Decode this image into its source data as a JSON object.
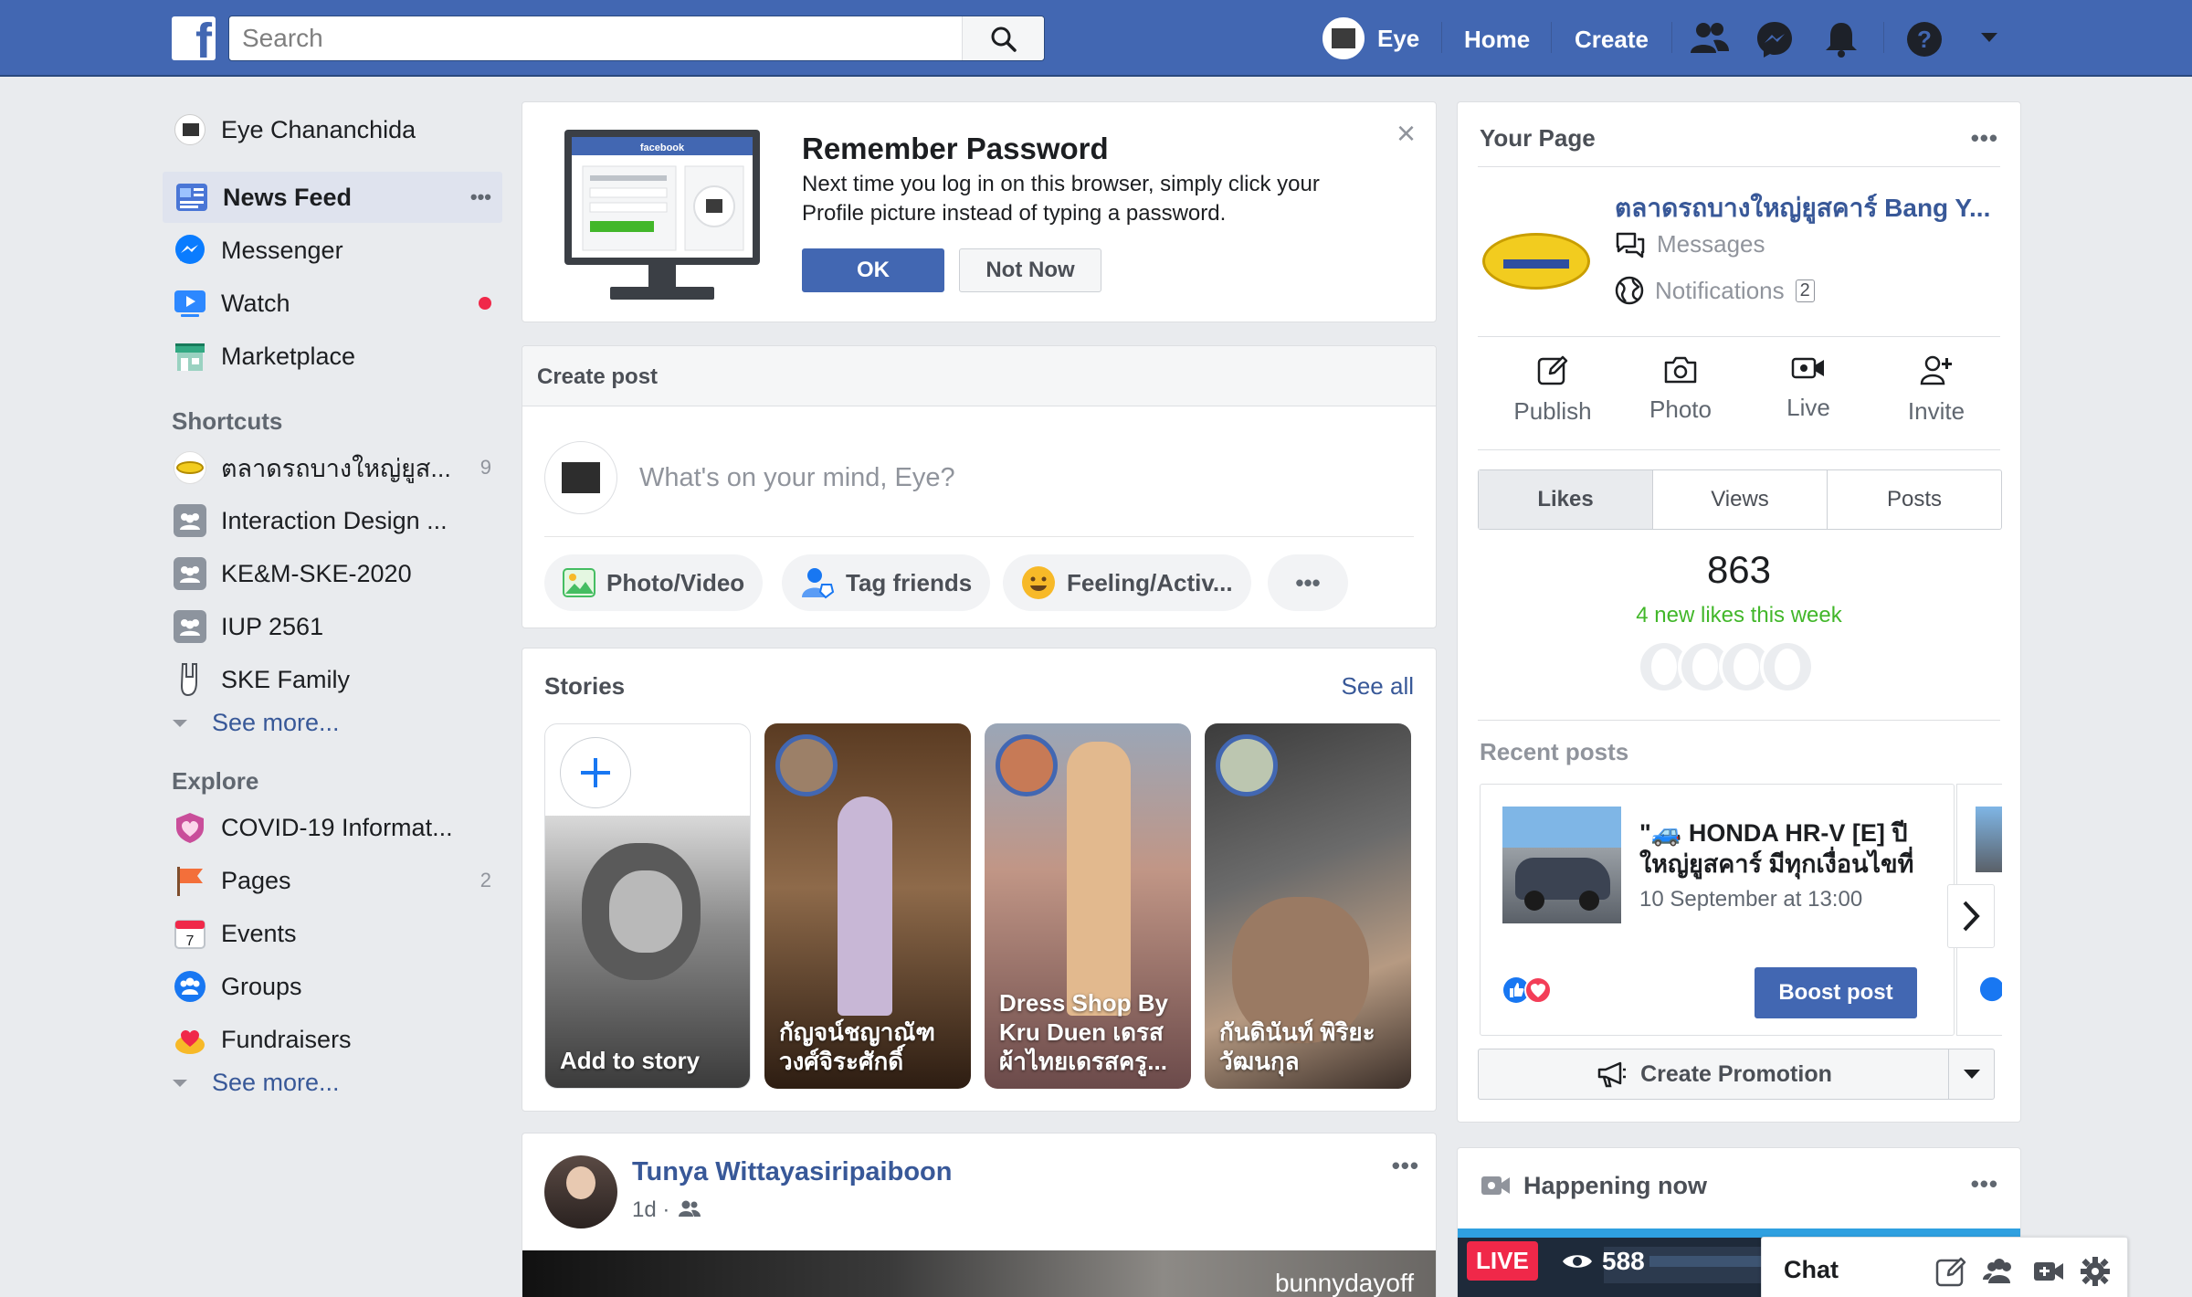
{
  "topbar": {
    "logo": "f",
    "search_placeholder": "Search",
    "profile_name": "Eye",
    "home": "Home",
    "create": "Create"
  },
  "sidebar": {
    "profile": "Eye Chananchida",
    "items": [
      {
        "label": "News Feed",
        "icon": "news-feed-icon"
      },
      {
        "label": "Messenger",
        "icon": "messenger-icon"
      },
      {
        "label": "Watch",
        "icon": "watch-icon"
      },
      {
        "label": "Marketplace",
        "icon": "marketplace-icon"
      }
    ],
    "more_dots": "•••",
    "shortcuts_heading": "Shortcuts",
    "shortcuts": [
      {
        "label": "ตลาดรถบางใหญ่ยูส...",
        "count": "9"
      },
      {
        "label": "Interaction Design ..."
      },
      {
        "label": "KE&M-SKE-2020"
      },
      {
        "label": "IUP 2561"
      },
      {
        "label": "SKE Family"
      }
    ],
    "see_more": "See more...",
    "explore_heading": "Explore",
    "explore": [
      {
        "label": "COVID-19 Informat..."
      },
      {
        "label": "Pages",
        "count": "2"
      },
      {
        "label": "Events"
      },
      {
        "label": "Groups"
      },
      {
        "label": "Fundraisers"
      }
    ],
    "see_more_2": "See more...",
    "colors": {
      "active_bg": "#dfe3ee",
      "link": "#385898",
      "notification_dot": "#f02849"
    }
  },
  "remember_password": {
    "monitor_brand": "facebook",
    "title": "Remember Password",
    "text": "Next time you log in on this browser, simply click your Profile picture instead of typing a password.",
    "ok": "OK",
    "not_now": "Not Now",
    "close": "×"
  },
  "create_post": {
    "header": "Create post",
    "placeholder": "What's on your mind, Eye?",
    "actions": [
      "Photo/Video",
      "Tag friends",
      "Feeling/Activ..."
    ],
    "more": "•••"
  },
  "stories": {
    "title": "Stories",
    "see_all": "See all",
    "items": [
      {
        "name": "Add to story"
      },
      {
        "name": "กัญจน์ชญาณัฑ วงศ์จิระศักดิ์"
      },
      {
        "name": "Dress Shop By Kru Duen เดรส ผ้าไทยเดรสครู..."
      },
      {
        "name": "กันดินันท์ พิริยะ วัฒนกุล"
      }
    ]
  },
  "post": {
    "author": "Tunya Wittayasiripaiboon",
    "time": "1d ·",
    "image_watermark": "bunnydayoff",
    "more": "•••"
  },
  "your_page": {
    "title": "Your Page",
    "more": "•••",
    "page_name": "ตลาดรถบางใหญ่ยูสคาร์ Bang Y...",
    "messages": "Messages",
    "notifications": "Notifications",
    "notifications_count": "2",
    "actions": [
      "Publish",
      "Photo",
      "Live",
      "Invite"
    ],
    "tabs": [
      "Likes",
      "Views",
      "Posts"
    ],
    "likes": "863",
    "new_likes": "4 new likes this week",
    "recent_posts_title": "Recent posts",
    "recent_post": {
      "title_line1": "\"🚙 HONDA HR-V [E] ปี",
      "title_line2": "ใหญ่ยูสคาร์ มีทุกเงื่อนไขที่",
      "date": "10 September at 13:00",
      "boost": "Boost post"
    },
    "create_promotion": "Create Promotion"
  },
  "happening_now": {
    "title": "Happening now",
    "more": "•••",
    "live": "LIVE",
    "viewers": "588"
  },
  "chat": {
    "label": "Chat"
  }
}
